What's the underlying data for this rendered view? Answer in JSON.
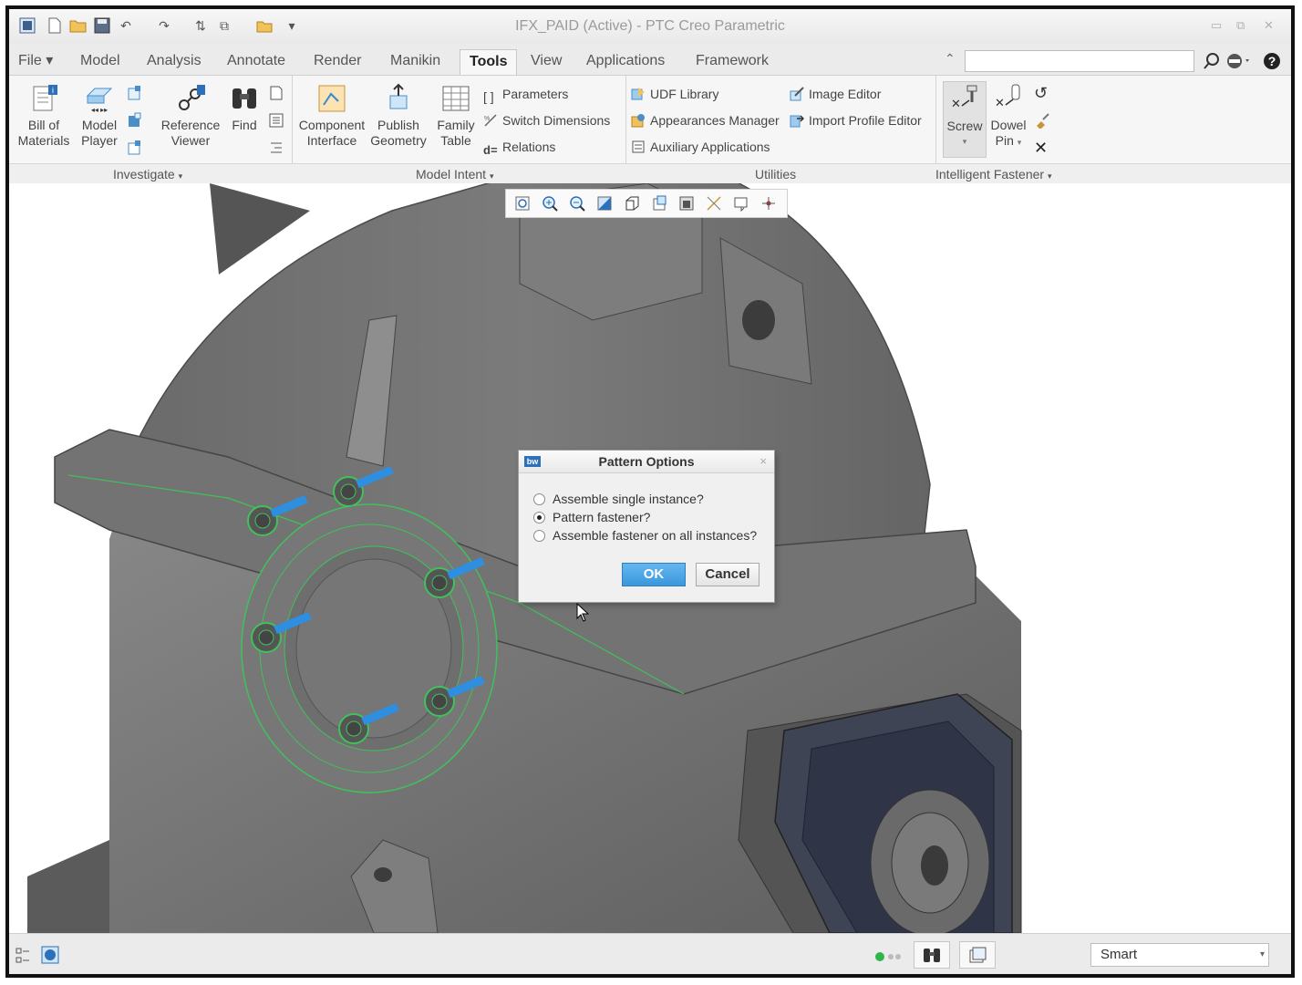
{
  "window": {
    "title": "IFX_PAID (Active) - PTC Creo Parametric",
    "controls": [
      "minimize-icon",
      "restore-icon",
      "close-icon"
    ]
  },
  "quick_access": [
    "app-menu-icon",
    "new-icon",
    "open-icon",
    "save-icon",
    "undo-icon",
    "redo-icon",
    "regenerate-icon",
    "windows-icon",
    "close-window-icon",
    "customize-icon"
  ],
  "tabs": [
    {
      "label": "File"
    },
    {
      "label": "Model"
    },
    {
      "label": "Analysis"
    },
    {
      "label": "Annotate"
    },
    {
      "label": "Render"
    },
    {
      "label": "Manikin"
    },
    {
      "label": "Tools"
    },
    {
      "label": "View"
    },
    {
      "label": "Applications"
    },
    {
      "label": "Framework"
    }
  ],
  "active_tab": "Tools",
  "ribbon": {
    "investigate": {
      "bill_of_materials": "Bill of\nMaterials",
      "model_player": "Model\nPlayer",
      "reference_viewer": "Reference\nViewer",
      "find": "Find"
    },
    "model_intent": {
      "component_interface": "Component\nInterface",
      "publish_geometry": "Publish\nGeometry",
      "family_table": "Family\nTable",
      "parameters": "Parameters",
      "switch_dimensions": "Switch Dimensions",
      "relations": "Relations",
      "relations_prefix": "d="
    },
    "utilities": {
      "udf_library": "UDF Library",
      "appearances_manager": "Appearances Manager",
      "auxiliary_applications": "Auxiliary Applications",
      "image_editor": "Image Editor",
      "import_profile_editor": "Import Profile Editor"
    },
    "intelligent_fastener": {
      "screw": "Screw",
      "dowel_pin": "Dowel\nPin"
    },
    "groups": {
      "investigate": "Investigate",
      "model_intent": "Model Intent",
      "utilities": "Utilities",
      "intelligent_fastener": "Intelligent Fastener"
    }
  },
  "dialog": {
    "title": "Pattern Options",
    "logo": "bw",
    "options": [
      {
        "label": "Assemble single instance?",
        "selected": false
      },
      {
        "label": "Pattern fastener?",
        "selected": true
      },
      {
        "label": "Assemble fastener on all instances?",
        "selected": false
      }
    ],
    "ok": "OK",
    "cancel": "Cancel"
  },
  "statusbar": {
    "filter_value": "Smart"
  },
  "colors": {
    "model_gray": "#6f6f6f",
    "edge_green": "#3fc25a",
    "bolt_blue": "#2e8fe0",
    "accent_blue": "#3a97dc"
  }
}
